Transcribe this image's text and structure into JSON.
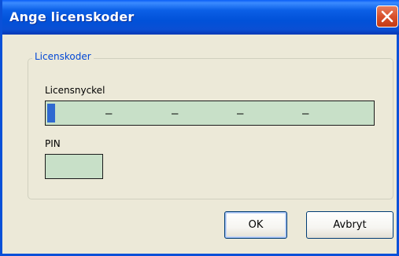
{
  "dialog": {
    "title": "Ange licenskoder",
    "close_icon": "close-icon"
  },
  "group": {
    "label": "Licenskoder"
  },
  "license_key": {
    "label": "Licensnyckel",
    "separators": [
      "–",
      "–",
      "–",
      "–"
    ]
  },
  "pin": {
    "label": "PIN"
  },
  "buttons": {
    "ok_label": "OK",
    "cancel_label": "Avbryt"
  },
  "colors": {
    "title_bar": "#0151d8",
    "field_background": "#c8e0c8",
    "group_label": "#0046d5",
    "close_button": "#d9512c"
  }
}
